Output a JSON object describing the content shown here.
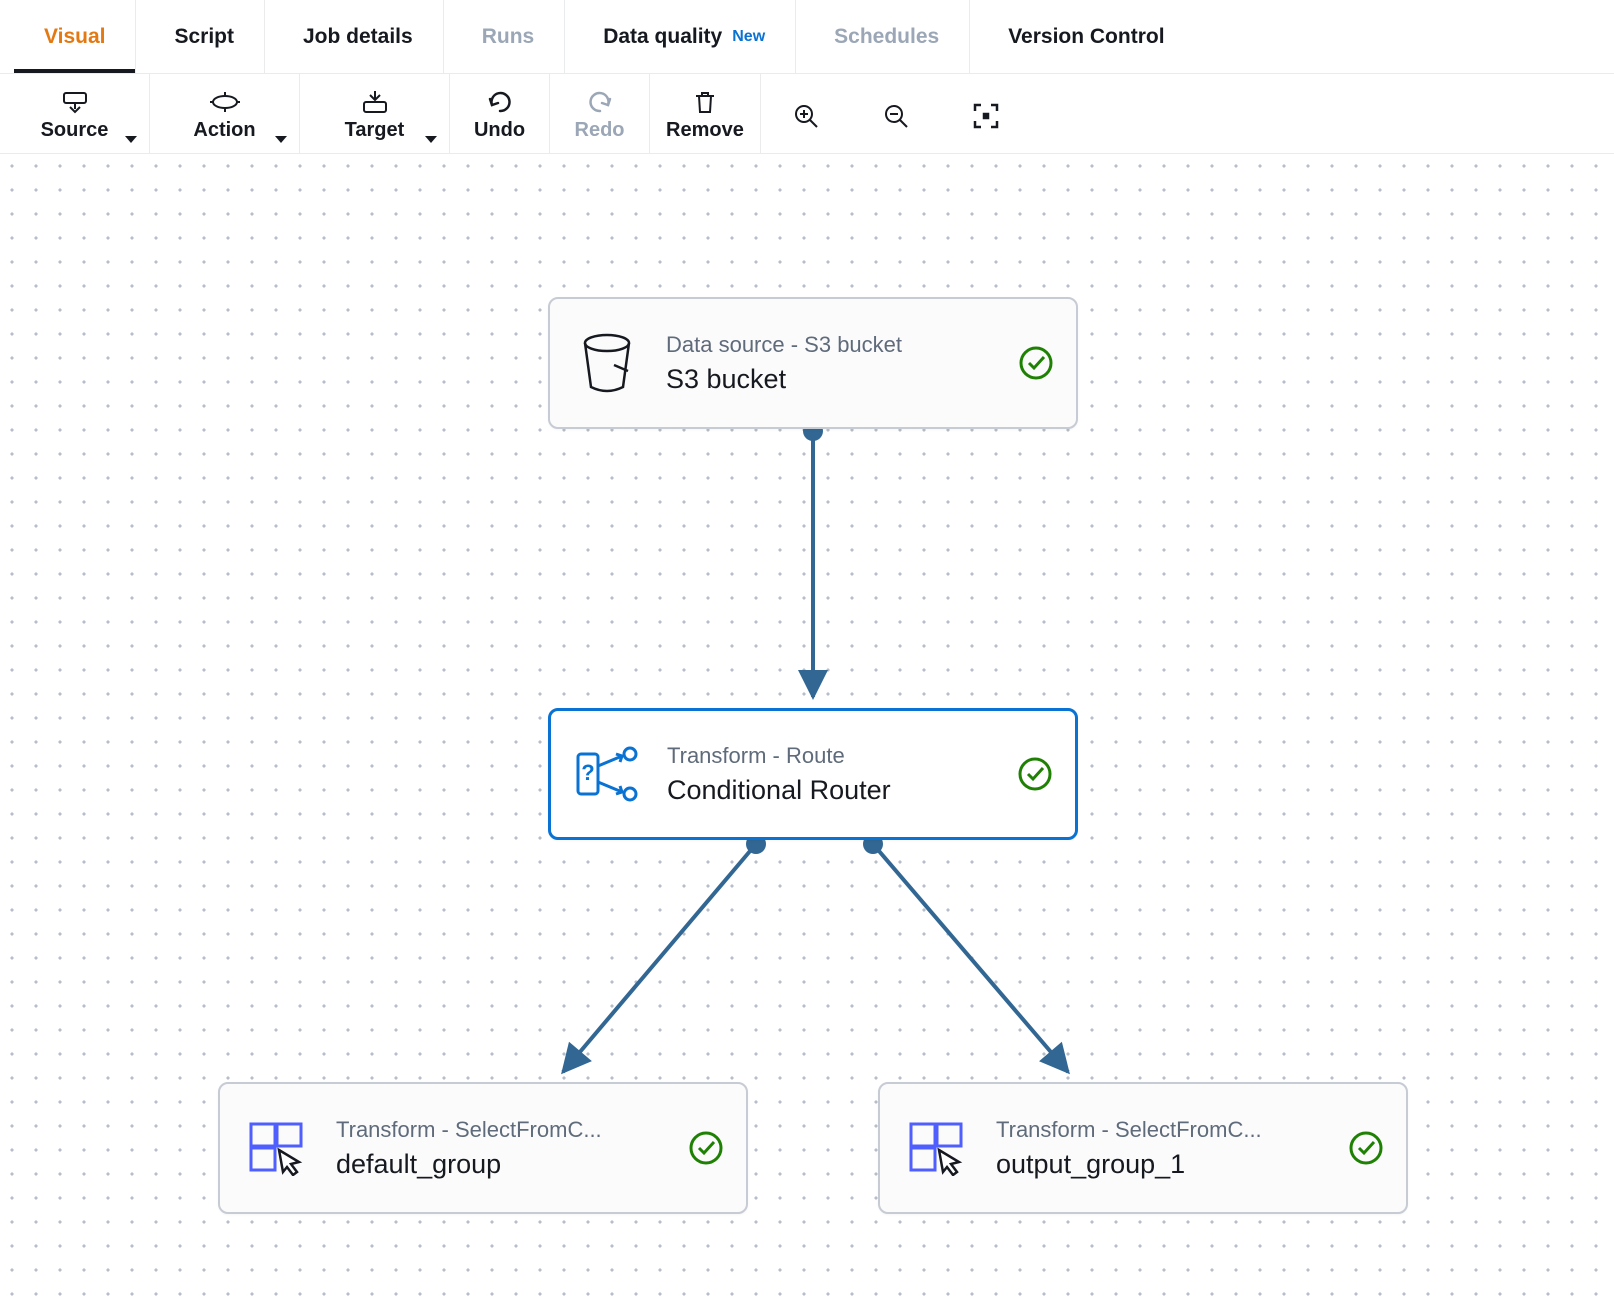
{
  "tabs": {
    "visual": {
      "label": "Visual",
      "state": "active"
    },
    "script": {
      "label": "Script",
      "state": "normal"
    },
    "details": {
      "label": "Job details",
      "state": "normal"
    },
    "runs": {
      "label": "Runs",
      "state": "disabled"
    },
    "dq": {
      "label": "Data quality",
      "state": "normal",
      "badge": "New"
    },
    "schedules": {
      "label": "Schedules",
      "state": "disabled"
    },
    "vcs": {
      "label": "Version Control",
      "state": "normal"
    }
  },
  "toolbar": {
    "source": "Source",
    "action": "Action",
    "target": "Target",
    "undo": "Undo",
    "redo": "Redo",
    "remove": "Remove"
  },
  "nodes": {
    "s3": {
      "subtitle": "Data source - S3 bucket",
      "title": "S3 bucket",
      "selected": false,
      "status": "ok"
    },
    "router": {
      "subtitle": "Transform - Route",
      "title": "Conditional Router",
      "selected": true,
      "status": "ok"
    },
    "default_group": {
      "subtitle": "Transform - SelectFromC...",
      "title": "default_group",
      "selected": false,
      "status": "ok"
    },
    "output_group_1": {
      "subtitle": "Transform - SelectFromC...",
      "title": "output_group_1",
      "selected": false,
      "status": "ok"
    }
  },
  "colors": {
    "edge": "#326793",
    "accent": "#0972d3",
    "success": "#1f8104",
    "orange": "#e47911"
  }
}
